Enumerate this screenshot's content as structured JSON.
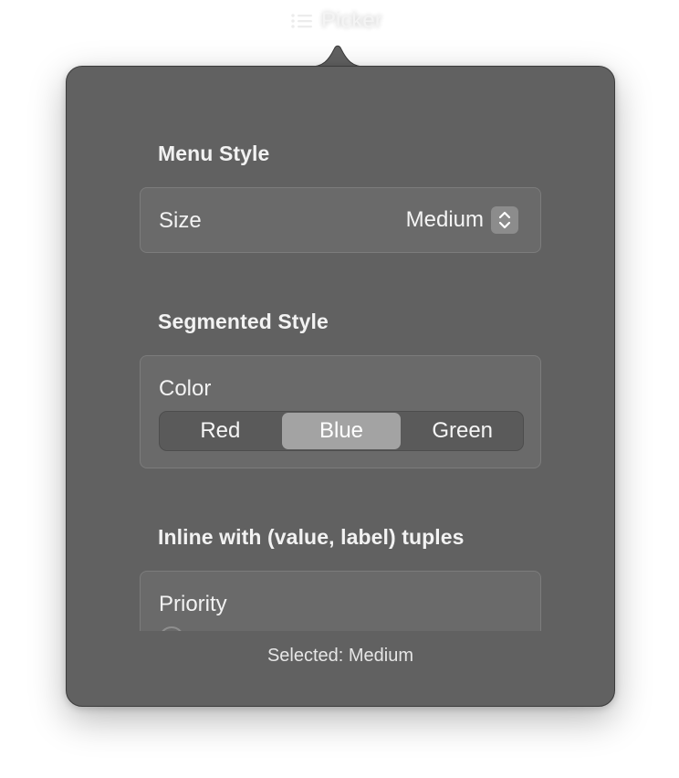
{
  "menubar": {
    "icon": "list-bullet-icon",
    "title": "Picker"
  },
  "sections": {
    "menu": {
      "title": "Menu Style",
      "row_label": "Size",
      "value": "Medium",
      "control_icon": "up-down-chevron-icon"
    },
    "segmented": {
      "title": "Segmented Style",
      "row_label": "Color",
      "options": [
        "Red",
        "Blue",
        "Green"
      ],
      "selected": "Blue"
    },
    "inline": {
      "title": "Inline with (value, label) tuples",
      "row_label": "Priority"
    }
  },
  "status": "Selected: Medium",
  "colors": {
    "popover_bg": "#616161",
    "group_bg": "#6a6a6a",
    "segment_selected": "#a3a3a3",
    "text": "#f2f2f2"
  }
}
